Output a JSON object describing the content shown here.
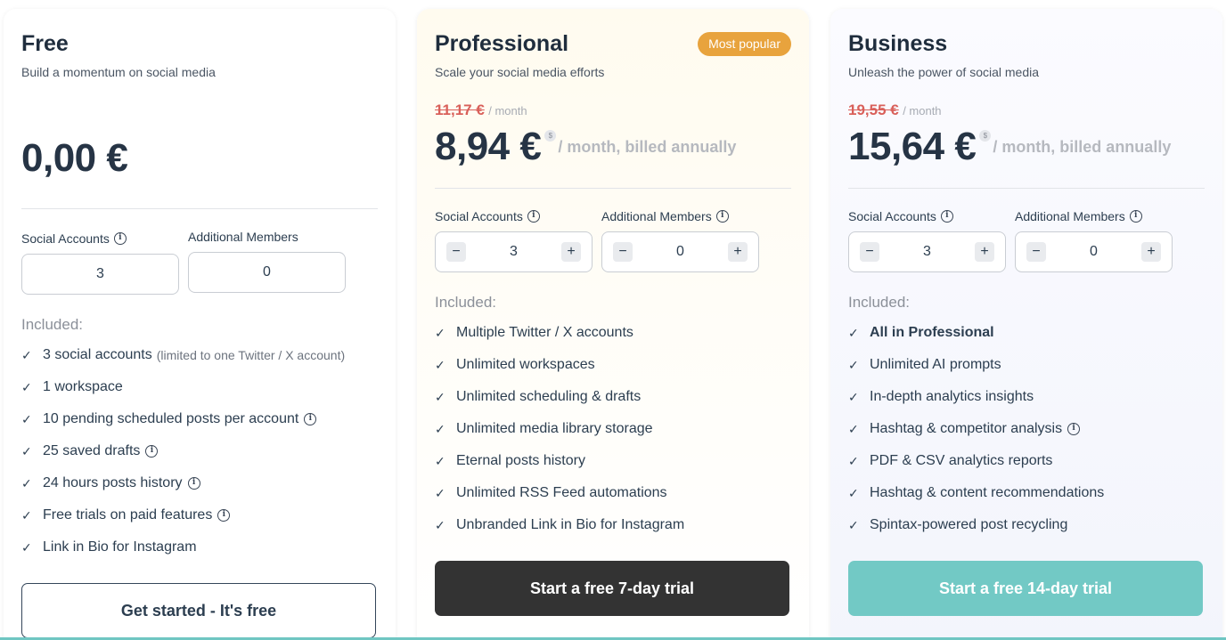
{
  "plans": [
    {
      "name": "Free",
      "tagline": "Build a momentum on social media",
      "price": "0,00 €",
      "social_label": "Social Accounts",
      "members_label": "Additional Members",
      "social_value": "3",
      "members_value": "0",
      "included_label": "Included:",
      "features": [
        {
          "text": "3 social accounts",
          "note": "(limited to one Twitter / X account)"
        },
        {
          "text": "1 workspace"
        },
        {
          "text": "10 pending scheduled posts per account"
        },
        {
          "text": "25 saved drafts"
        },
        {
          "text": "24 hours posts history"
        },
        {
          "text": "Free trials on paid features"
        },
        {
          "text": "Link in Bio for Instagram"
        }
      ],
      "cta": "Get started - It's free"
    },
    {
      "name": "Professional",
      "badge": "Most popular",
      "tagline": "Scale your social media efforts",
      "old_price": "11,17 €",
      "old_period": "/ month",
      "price": "8,94 €",
      "currency_icon": "$",
      "period": "/ month, billed annually",
      "social_label": "Social Accounts",
      "members_label": "Additional Members",
      "social_value": "3",
      "members_value": "0",
      "minus": "−",
      "plus": "+",
      "included_label": "Included:",
      "features": [
        {
          "text": "Multiple Twitter / X accounts"
        },
        {
          "text": "Unlimited workspaces"
        },
        {
          "text": "Unlimited scheduling & drafts"
        },
        {
          "text": "Unlimited media library storage"
        },
        {
          "text": "Eternal posts history"
        },
        {
          "text": "Unlimited RSS Feed automations"
        },
        {
          "text": "Unbranded Link in Bio for Instagram"
        }
      ],
      "cta": "Start a free 7-day trial"
    },
    {
      "name": "Business",
      "tagline": "Unleash the power of social media",
      "old_price": "19,55 €",
      "old_period": "/ month",
      "price": "15,64 €",
      "currency_icon": "$",
      "period": "/ month, billed annually",
      "social_label": "Social Accounts",
      "members_label": "Additional Members",
      "social_value": "3",
      "members_value": "0",
      "minus": "−",
      "plus": "+",
      "included_label": "Included:",
      "features": [
        {
          "text": "All in Professional"
        },
        {
          "text": "Unlimited AI prompts"
        },
        {
          "text": "In-depth analytics insights"
        },
        {
          "text": "Hashtag & competitor analysis"
        },
        {
          "text": "PDF & CSV analytics reports"
        },
        {
          "text": "Hashtag & content recommendations"
        },
        {
          "text": "Spintax-powered post recycling"
        }
      ],
      "cta": "Start a free 14-day trial"
    }
  ],
  "icons": {
    "check": "check-icon",
    "info": "info-icon",
    "currency": "dollar-icon"
  },
  "colors": {
    "badge": "#e8a33d",
    "old_price": "#d9605a",
    "cta_pro": "#333333",
    "cta_business": "#72c9c5"
  },
  "glyphs": {
    "check": "✓",
    "info": "i"
  }
}
